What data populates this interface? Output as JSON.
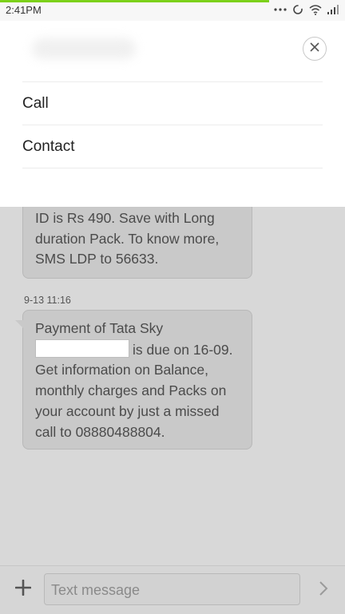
{
  "status_bar": {
    "time": "2:41PM",
    "icons": [
      "more-dots-icon",
      "sync-icon",
      "wifi-icon",
      "signal-icon"
    ]
  },
  "sheet": {
    "menu_items": [
      {
        "label": "Call"
      },
      {
        "label": "Contact"
      }
    ],
    "close_icon": "close-icon"
  },
  "conversation": {
    "messages": [
      {
        "text_lines": [
          "ID is Rs 490. Save with Long",
          "duration Pack. To know more,",
          "SMS LDP to 56633."
        ]
      },
      {
        "timestamp": "9-13 11:16",
        "line1": "Payment of Tata Sky",
        "line2_suffix": "is due on 16-09.",
        "rest_lines": [
          "Get information on Balance,",
          "monthly charges and Packs on",
          "your account by just a missed",
          "call to 08880488804."
        ]
      }
    ]
  },
  "composer": {
    "placeholder": "Text message",
    "add_icon": "plus-icon",
    "send_icon": "send-chevron-icon"
  },
  "colors": {
    "accent_progress": "#7cd11a",
    "dim_background": "#d8d8d8",
    "sheet_background": "#ffffff"
  }
}
